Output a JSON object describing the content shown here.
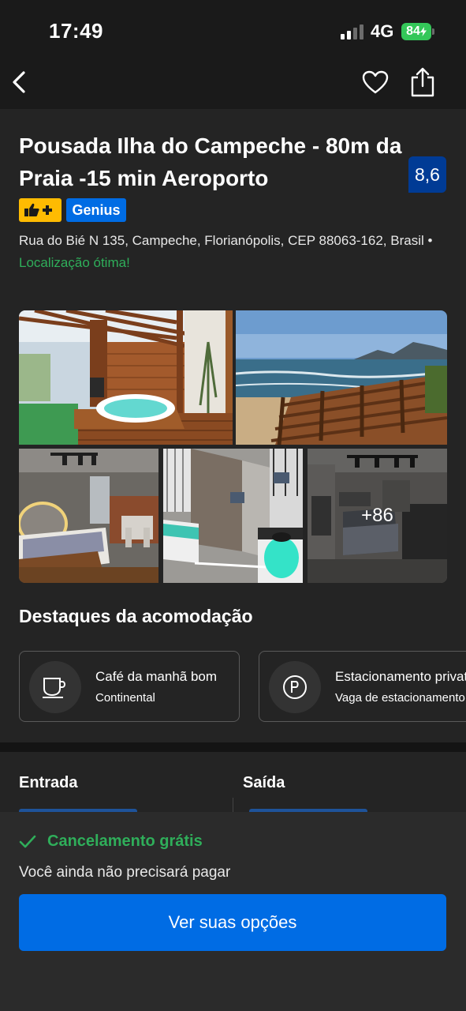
{
  "status_bar": {
    "time": "17:49",
    "network": "4G",
    "battery": "84",
    "battery_color": "#34c759"
  },
  "nav": {
    "back_icon": "chevron-left-icon",
    "favorite_icon": "heart-outline-icon",
    "share_icon": "share-icon"
  },
  "property": {
    "title": "Pousada Ilha do Campeche - 80m da Praia -15 min Aeroporto",
    "score": "8,6",
    "score_color": "#003b95",
    "badge_genius": "Genius",
    "badge_thumbs_icon": "thumbs-up-plus-icon",
    "address": "Rua do Bié N 135, Campeche, Florianópolis, CEP 88063-162, Brasil",
    "location_separator": "•",
    "location_rating": "Localização ótima!",
    "location_color": "#2fae5a"
  },
  "gallery": {
    "more_photos": "+86"
  },
  "highlights": {
    "title": "Destaques da acomodação",
    "items": [
      {
        "icon": "coffee-cup-icon",
        "title": "Café da manhã bom",
        "subtitle": "Continental"
      },
      {
        "icon": "parking-icon",
        "title": "Estacionamento privativo",
        "subtitle": "Vaga de estacionamento"
      }
    ]
  },
  "dates": {
    "check_in_label": "Entrada",
    "check_out_label": "Saída"
  },
  "booking": {
    "cancellation": "Cancelamento grátis",
    "pay_later": "Você ainda não precisará pagar",
    "cta": "Ver suas opções",
    "cta_color": "#006ce4"
  }
}
